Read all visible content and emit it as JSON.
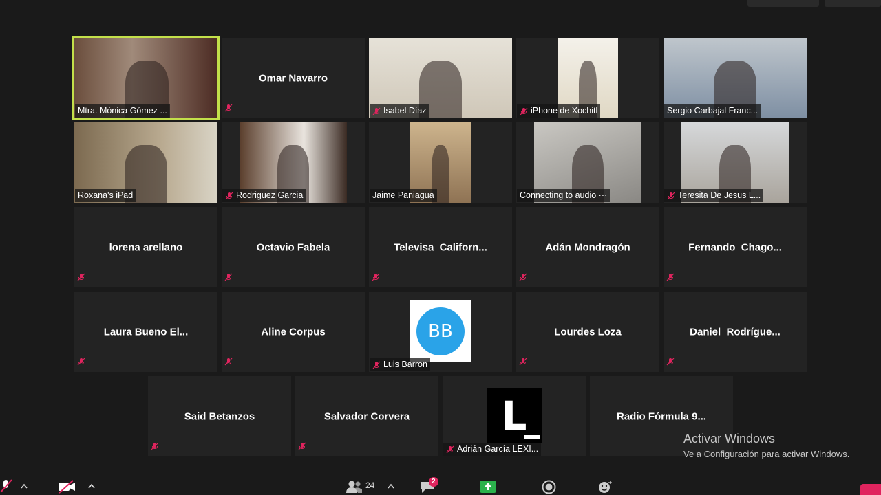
{
  "tiles": [
    {
      "name": "Mtra. Mónica Gómez ...",
      "type": "video",
      "muted": false,
      "active": true
    },
    {
      "name": "Omar Navarro",
      "type": "name",
      "muted": true
    },
    {
      "name": "Isabel Díaz",
      "type": "video",
      "muted": true
    },
    {
      "name": "iPhone de Xochitl",
      "type": "video",
      "muted": true
    },
    {
      "name": "Sergio Carbajal Franc...",
      "type": "video",
      "muted": false
    },
    {
      "name": "Roxana's iPad",
      "type": "video",
      "muted": false
    },
    {
      "name": "Rodriguez Garcia",
      "type": "video",
      "muted": true
    },
    {
      "name": "Jaime Paniagua",
      "type": "video",
      "muted": false
    },
    {
      "name": "Connecting to audio ···",
      "type": "video",
      "muted": false
    },
    {
      "name": "Teresita De Jesus L...",
      "type": "video",
      "muted": true
    },
    {
      "name": "lorena arellano",
      "type": "name",
      "muted": true
    },
    {
      "name": "Octavio Fabela",
      "type": "name",
      "muted": true
    },
    {
      "name": "Televisa  Californ...",
      "type": "name",
      "muted": true
    },
    {
      "name": "Adán Mondragón",
      "type": "name",
      "muted": true
    },
    {
      "name": "Fernando  Chago...",
      "type": "name",
      "muted": true
    },
    {
      "name": "Laura Bueno El...",
      "type": "name",
      "muted": true
    },
    {
      "name": "Aline Corpus",
      "type": "name",
      "muted": true
    },
    {
      "name": "Luis Barron",
      "type": "avatar",
      "avatar_text": "BB",
      "muted": true
    },
    {
      "name": "Lourdes Loza",
      "type": "name",
      "muted": true
    },
    {
      "name": "Daniel  Rodrígue...",
      "type": "name",
      "muted": true
    },
    {
      "name": "Said Betanzos",
      "type": "name",
      "muted": true
    },
    {
      "name": "Salvador Corvera",
      "type": "name",
      "muted": true
    },
    {
      "name": "Adrián García LEXI...",
      "type": "logo",
      "logo_text": "L",
      "muted": true
    },
    {
      "name": "Radio Fórmula 9...",
      "type": "name",
      "muted": false
    }
  ],
  "toolbar": {
    "participants_count": "24",
    "chat_badge": "2"
  },
  "watermark": {
    "title": "Activar Windows",
    "subtitle": "Ve a Configuración para activar Windows."
  },
  "colors": {
    "background": "#1a1a1a",
    "tile": "#232323",
    "active_border": "#c3e04a",
    "share_green": "#2bb24c",
    "badge_red": "#e0245e",
    "mute_red": "#e0245e",
    "avatar_blue": "#2aa3e8"
  }
}
